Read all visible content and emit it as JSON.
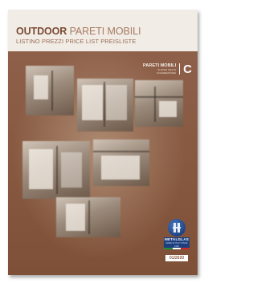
{
  "cover": {
    "title_strong": "OUTDOOR",
    "title_light": "PARETI MOBILI",
    "subtitle": "LISTINO PREZZI PRICE LIST PREISLISTE"
  },
  "series": {
    "name": "PARETI MOBILI",
    "line2": "SLIDING WALLS",
    "line3": "SCHIEBEWÄNDE",
    "letter": "C"
  },
  "logo": {
    "name": "METALGLAS",
    "tagline": "MADE IN ITALY SINCE 1969",
    "icon": "metalglas-logo-icon"
  },
  "edition": {
    "date": "01/2020"
  },
  "colors": {
    "brand_brown": "#7a4a32",
    "cover_background": "#8a5c45",
    "top_band": "#f1ece6",
    "logo_blue": "#1c3f7f",
    "flag_green": "#1f8f3a",
    "flag_white": "#ffffff",
    "flag_red": "#cc2a2a"
  }
}
